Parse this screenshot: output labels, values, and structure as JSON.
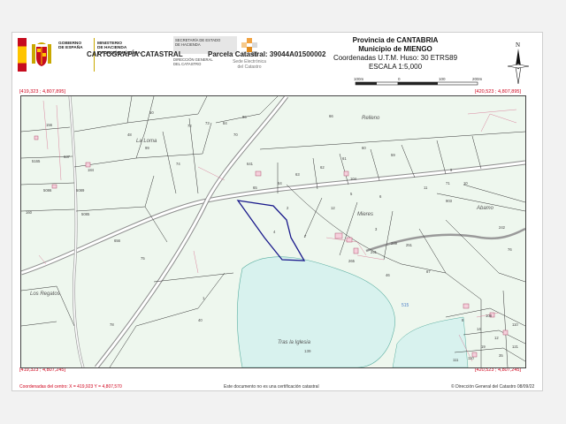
{
  "header": {
    "gov_line1": "GOBIERNO",
    "gov_line2": "DE ESPAÑA",
    "min_line1": "MINISTERIO",
    "min_line2": "DE HACIENDA",
    "min_line3": "Y FUNCIÓN PÚBLICA",
    "sec_line1": "SECRETARÍA DE ESTADO",
    "sec_line2": "DE HACIENDA",
    "dir_line1": "DIRECCIÓN GENERAL",
    "dir_line2": "DEL CATASTRO",
    "sede_line1": "Sede Electrónica",
    "sede_line2": "del Catastro",
    "province": "Provincia de CANTABRIA",
    "municipality": "Municipio de MIENGO",
    "coords_system": "Coordenadas U.T.M. Huso: 30 ETRS89",
    "scale": "ESCALA 1:5,000",
    "scale_ticks": [
      "100m",
      "0",
      "100",
      "200m"
    ],
    "north_letter": "N"
  },
  "titlebar": {
    "title": "CARTOGRAFÍA CATASTRAL",
    "parcel": "Parcela Catastral: 39044A01500002",
    "coord_tl": "[419,323 ; 4,807,895]",
    "coord_tr": "[420,523 ; 4,807,895]",
    "coord_bl": "[419,323 ; 4,807,245]",
    "coord_br": "[420,523 ; 4,807,245]"
  },
  "map": {
    "place_la_loma": "La Loma",
    "place_relleno": "Relleno",
    "place_mieres": "Mieres",
    "place_abamo": "Abamo",
    "place_regatos": "Los Regatos",
    "place_iglesia": "Tras la Iglesia",
    "parcel_numbers": [
      "156",
      "66",
      "50",
      "48",
      "72",
      "73",
      "84",
      "86",
      "70",
      "74",
      "99",
      "5165",
      "637",
      "184",
      "5086",
      "5089",
      "160",
      "5085",
      "656",
      "75",
      "641",
      "65",
      "64",
      "63",
      "62",
      "61",
      "60",
      "59",
      "71",
      "104",
      "903",
      "10",
      "11",
      "9",
      "12",
      "5",
      "6",
      "7",
      "4",
      "2",
      "3",
      "251",
      "289",
      "291",
      "265",
      "87",
      "46",
      "242",
      "76",
      "8",
      "139",
      "515",
      "141",
      "78",
      "76",
      "40",
      "1",
      "12",
      "14",
      "19",
      "110",
      "35",
      "121",
      "110",
      "111",
      "108",
      "112",
      "117"
    ],
    "small_label_a": "515",
    "small_label_b": "139"
  },
  "footer": {
    "center_coords": "Coordenadas del centro: X = 419,923 Y = 4,807,570",
    "disclaimer": "Este documento no es una certificación catastral",
    "copyright": "© Dirección General del Catastro 08/09/22"
  },
  "colors": {
    "coord_red": "#d0021b",
    "parcel_line": "#1a1a8c",
    "land": "#eef7ee",
    "water": "#d8f2ee"
  }
}
